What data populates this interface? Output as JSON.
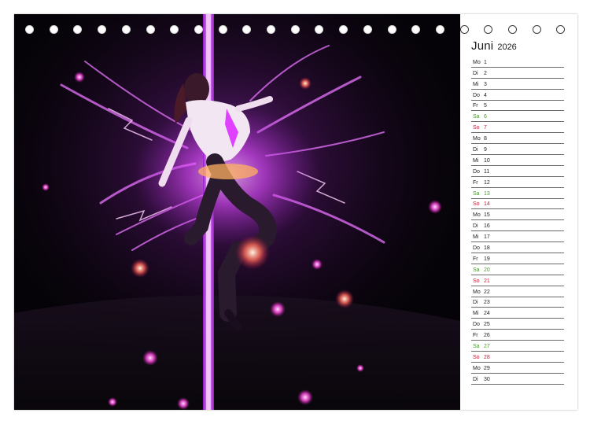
{
  "calendar": {
    "month": "Juni",
    "year": "2026",
    "days": [
      {
        "wd": "Mo",
        "d": "1",
        "type": "weekday"
      },
      {
        "wd": "Di",
        "d": "2",
        "type": "weekday"
      },
      {
        "wd": "Mi",
        "d": "3",
        "type": "weekday"
      },
      {
        "wd": "Do",
        "d": "4",
        "type": "weekday"
      },
      {
        "wd": "Fr",
        "d": "5",
        "type": "weekday"
      },
      {
        "wd": "Sa",
        "d": "6",
        "type": "sat"
      },
      {
        "wd": "So",
        "d": "7",
        "type": "sun"
      },
      {
        "wd": "Mo",
        "d": "8",
        "type": "weekday"
      },
      {
        "wd": "Di",
        "d": "9",
        "type": "weekday"
      },
      {
        "wd": "Mi",
        "d": "10",
        "type": "weekday"
      },
      {
        "wd": "Do",
        "d": "11",
        "type": "weekday"
      },
      {
        "wd": "Fr",
        "d": "12",
        "type": "weekday"
      },
      {
        "wd": "Sa",
        "d": "13",
        "type": "sat"
      },
      {
        "wd": "So",
        "d": "14",
        "type": "sun"
      },
      {
        "wd": "Mo",
        "d": "15",
        "type": "weekday"
      },
      {
        "wd": "Di",
        "d": "16",
        "type": "weekday"
      },
      {
        "wd": "Mi",
        "d": "17",
        "type": "weekday"
      },
      {
        "wd": "Do",
        "d": "18",
        "type": "weekday"
      },
      {
        "wd": "Fr",
        "d": "19",
        "type": "weekday"
      },
      {
        "wd": "Sa",
        "d": "20",
        "type": "sat"
      },
      {
        "wd": "So",
        "d": "21",
        "type": "sun"
      },
      {
        "wd": "Mo",
        "d": "22",
        "type": "weekday"
      },
      {
        "wd": "Di",
        "d": "23",
        "type": "weekday"
      },
      {
        "wd": "Mi",
        "d": "24",
        "type": "weekday"
      },
      {
        "wd": "Do",
        "d": "25",
        "type": "weekday"
      },
      {
        "wd": "Fr",
        "d": "26",
        "type": "weekday"
      },
      {
        "wd": "Sa",
        "d": "27",
        "type": "sat"
      },
      {
        "wd": "So",
        "d": "28",
        "type": "sun"
      },
      {
        "wd": "Mo",
        "d": "29",
        "type": "weekday"
      },
      {
        "wd": "Di",
        "d": "30",
        "type": "weekday"
      }
    ]
  },
  "colors": {
    "saturday": "#4a9a2e",
    "sunday": "#c5213a",
    "glow": "#d23cff",
    "background": "#050307"
  }
}
